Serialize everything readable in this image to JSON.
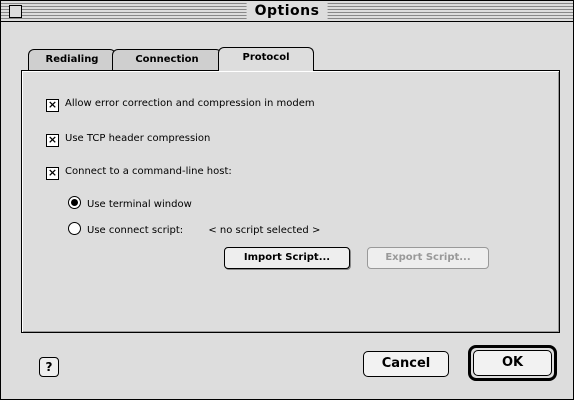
{
  "window": {
    "title": "Options"
  },
  "tabs": [
    {
      "label": "Redialing",
      "active": false
    },
    {
      "label": "Connection",
      "active": false
    },
    {
      "label": "Protocol",
      "active": true
    }
  ],
  "protocol": {
    "error_correction": {
      "label": "Allow error correction and compression in modem",
      "checked": true
    },
    "tcp_header": {
      "label": "Use TCP header compression",
      "checked": true
    },
    "command_line": {
      "label": "Connect to a command-line host:",
      "checked": true
    },
    "terminal_window": {
      "label": "Use terminal window",
      "selected": true
    },
    "connect_script": {
      "label": "Use connect script:",
      "selected": false,
      "value": "< no script selected >"
    },
    "import_button": "Import Script...",
    "export_button": "Export Script..."
  },
  "footer": {
    "help_icon": "?",
    "cancel_label": "Cancel",
    "ok_label": "OK"
  }
}
